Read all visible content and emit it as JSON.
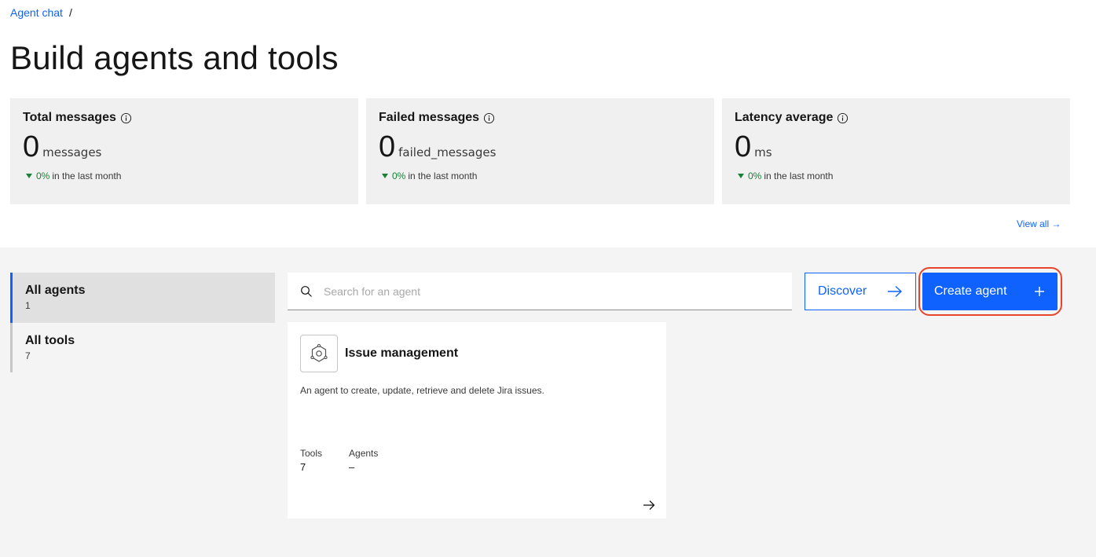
{
  "breadcrumb": {
    "link": "Agent chat",
    "separator": "/"
  },
  "page_title": "Build agents and tools",
  "tiles": [
    {
      "title": "Total messages",
      "value": "0",
      "unit": "messages",
      "trend_pct": "0%",
      "trend_text": "in the last month"
    },
    {
      "title": "Failed messages",
      "value": "0",
      "unit": "failed_messages",
      "trend_pct": "0%",
      "trend_text": "in the last month"
    },
    {
      "title": "Latency average",
      "value": "0",
      "unit": "ms",
      "trend_pct": "0%",
      "trend_text": "in the last month"
    }
  ],
  "view_all": "View all →",
  "sidenav": [
    {
      "label": "All agents",
      "count": "1"
    },
    {
      "label": "All tools",
      "count": "7"
    }
  ],
  "search": {
    "placeholder": "Search for an agent",
    "value": ""
  },
  "buttons": {
    "discover": "Discover",
    "create_agent": "Create agent"
  },
  "card": {
    "name": "Issue management",
    "description": "An agent to create, update, retrieve and delete Jira issues.",
    "tools_label": "Tools",
    "tools_value": "7",
    "agents_label": "Agents",
    "agents_value": "–"
  },
  "colors": {
    "accent": "#0f62fe",
    "trend_green": "#198038",
    "highlight_ring": "#e8442b"
  },
  "icons": [
    "info-icon",
    "search-icon",
    "arrow-right-icon",
    "plus-icon",
    "agent-hexagon-icon",
    "caret-down-icon"
  ]
}
